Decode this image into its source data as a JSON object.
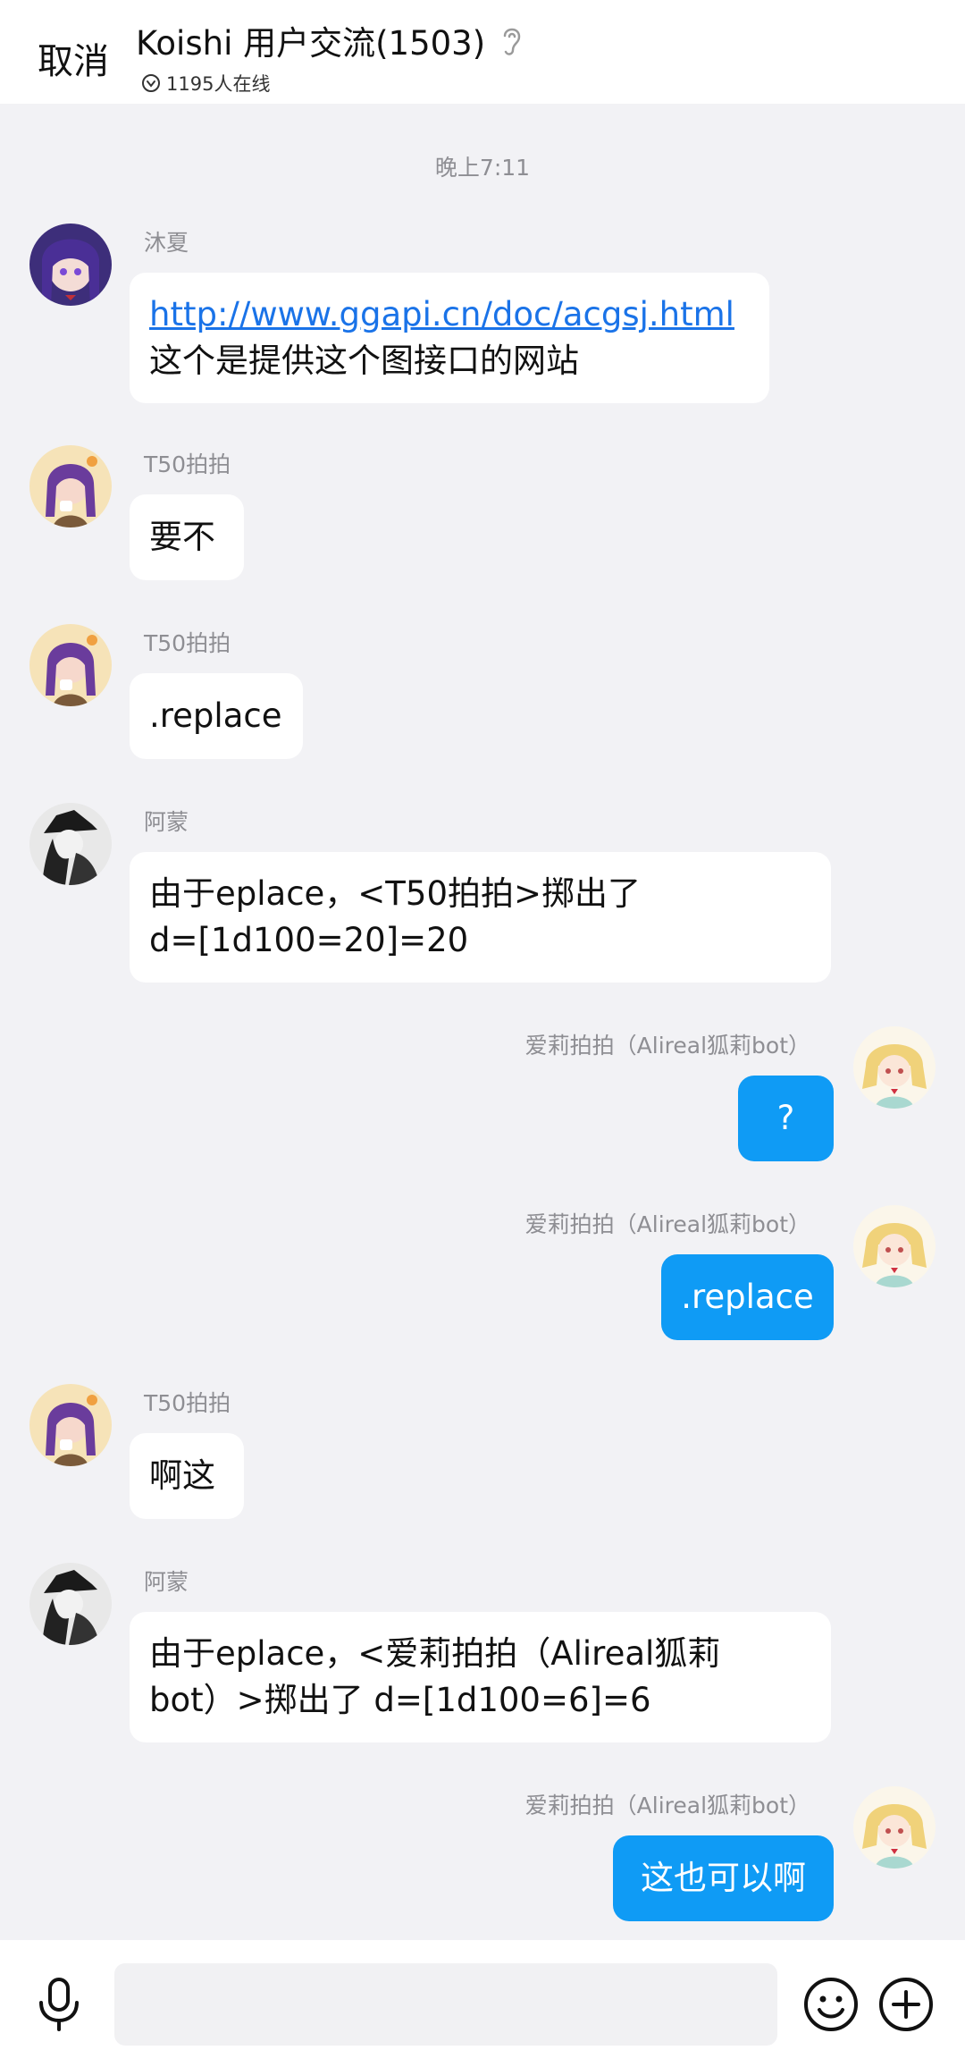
{
  "header": {
    "cancel_label": "取消",
    "title": "Koishi 用户交流(1503)",
    "online_count": "1195人在线"
  },
  "time_divider": "晚上7:11",
  "messages": [
    {
      "sender": "沐夏",
      "line1": "http://www.ggapi.cn/doc/acgsj.html",
      "line2": "这个是提供这个图接口的网站"
    },
    {
      "sender": "T50拍拍",
      "text": "要不"
    },
    {
      "sender": "T50拍拍",
      "text": ".replace"
    },
    {
      "sender": "阿蒙",
      "line1": "由于eplace，<T50拍拍>掷出了",
      "line2": "d=[1d100=20]=20"
    },
    {
      "sender": "爱莉拍拍（Alireal狐莉bot）",
      "text": "?"
    },
    {
      "sender": "爱莉拍拍（Alireal狐莉bot）",
      "text": ".replace"
    },
    {
      "sender": "T50拍拍",
      "text": "啊这"
    },
    {
      "sender": "阿蒙",
      "line1": "由于eplace，<爱莉拍拍（Alireal狐莉",
      "line2": "bot）>掷出了 d=[1d100=6]=6"
    },
    {
      "sender": "爱莉拍拍（Alireal狐莉bot）",
      "text": "这也可以啊"
    }
  ],
  "input": {
    "placeholder": ""
  },
  "icons": [
    "ear-icon",
    "online-status-icon",
    "microphone-icon",
    "emoji-icon",
    "plus-icon"
  ],
  "colors": {
    "outgoing_bubble": "#0f9bf5",
    "link": "#1a73e8",
    "background": "#f2f2f5"
  }
}
